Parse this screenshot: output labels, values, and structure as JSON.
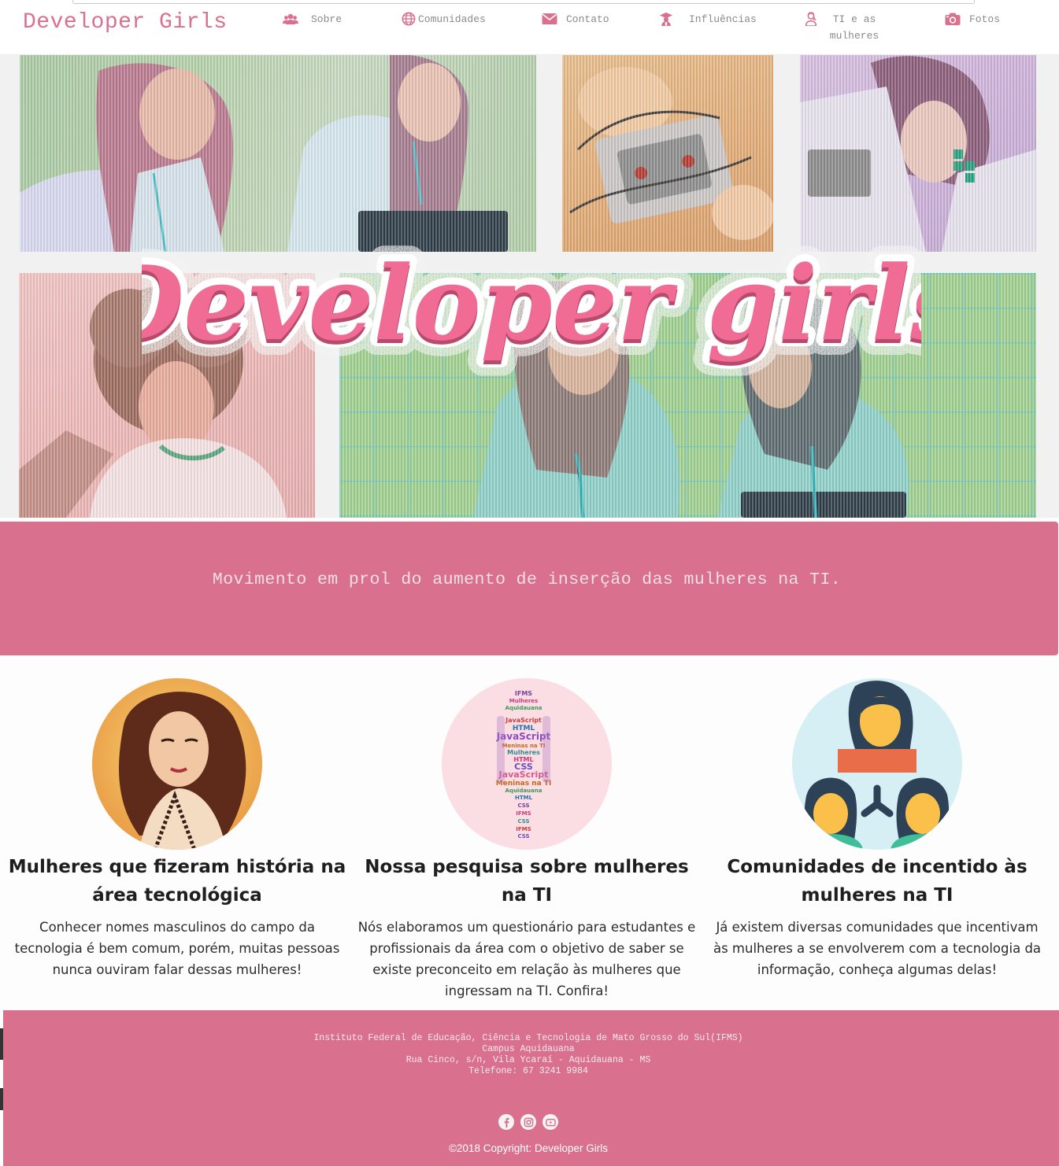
{
  "nav": {
    "brand": "Developer Girls",
    "items": [
      {
        "label": "Sobre",
        "icon": "users-icon"
      },
      {
        "label": "Comunidades",
        "icon": "globe-icon"
      },
      {
        "label": "Contato",
        "icon": "envelope-icon"
      },
      {
        "label": "Influências",
        "icon": "graduate-icon"
      },
      {
        "label": "TI e as mulheres",
        "icon": "woman-icon"
      },
      {
        "label": "Fotos",
        "icon": "camera-icon"
      }
    ]
  },
  "hero": {
    "title": "Developer girls"
  },
  "banner": {
    "text": "Movimento em prol do aumento de inserção das mulheres na TI."
  },
  "features": [
    {
      "title": "Mulheres que fizeram história na área tecnológica",
      "text": "Conhecer nomes masculinos do campo da tecnologia é bem comum, porém, muitas pessoas nunca ouviram falar dessas mulheres!"
    },
    {
      "title": "Nossa pesquisa sobre mulheres na TI",
      "text": "Nós elaboramos um questionário para estudantes e profissionais da área com o objetivo de saber se existe preconceito em relação às mulheres que ingressam na TI. Confira!",
      "cloud_words": [
        "IFMS",
        "Mulheres",
        "HTML",
        "JavaScript",
        "CSS",
        "Aquidauana",
        "Meninas na TI"
      ]
    },
    {
      "title": "Comunidades de incentido às mulheres na TI",
      "text": "Já existem diversas comunidades que incentivam às mulheres a se envolverem com a tecnologia da informação, conheça algumas delas!"
    }
  ],
  "footer": {
    "address_lines": [
      "Instituto Federal de Educação, Ciência e Tecnologia de Mato Grosso do Sul(IFMS)",
      "Campus Aquidauana",
      "Rua Cinco, s/n, Vila Ycaraí - Aquidauana - MS",
      "Telefone: 67 3241 9984"
    ],
    "socials": [
      "facebook-icon",
      "instagram-icon",
      "youtube-icon"
    ],
    "copyright": "©2018 Copyright: Developer Girls"
  },
  "colors": {
    "brand_pink": "#d9708e",
    "title_pink": "#f06c94",
    "nav_icon_pink": "#d9708e"
  }
}
